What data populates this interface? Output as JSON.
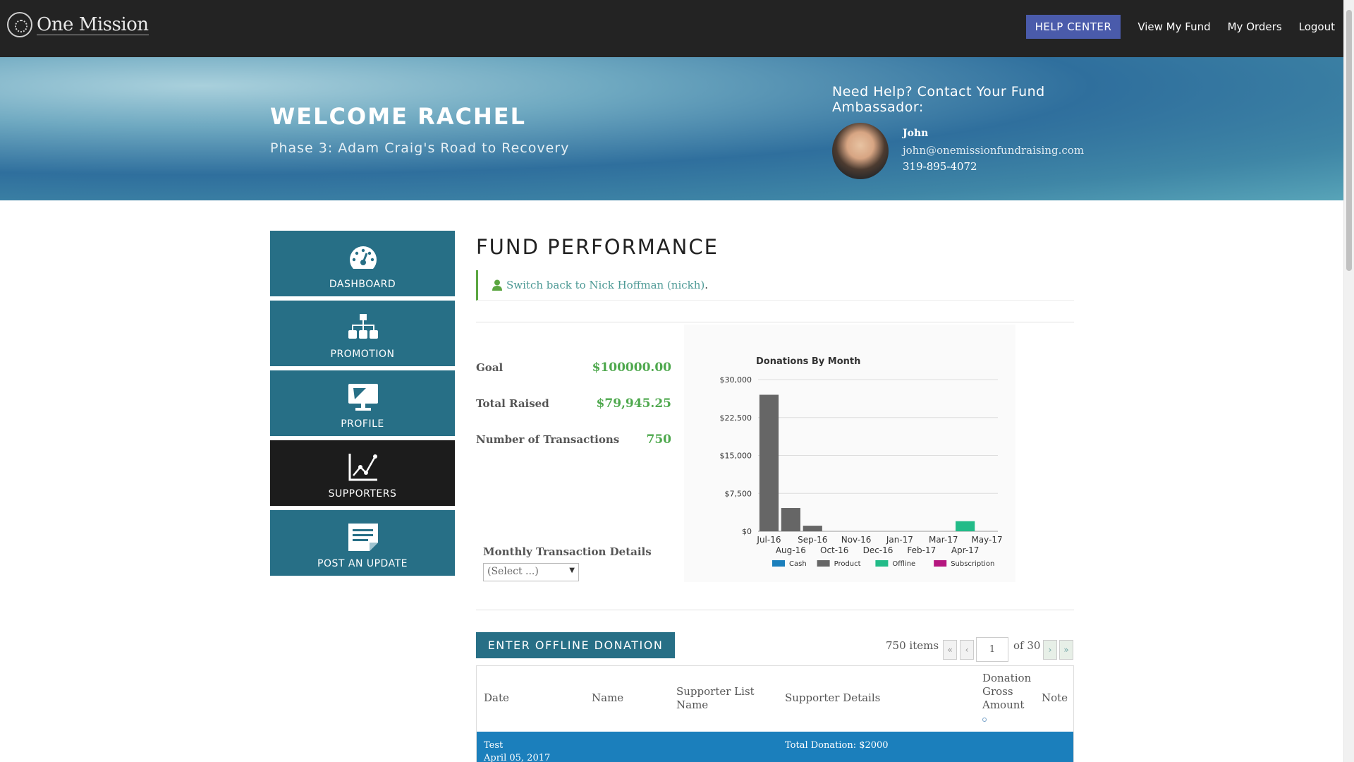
{
  "topbar": {
    "logo_text": "One Mission",
    "nav": {
      "help": "HELP CENTER",
      "view_fund": "View My Fund",
      "orders": "My Orders",
      "logout": "Logout"
    }
  },
  "hero": {
    "welcome": "WELCOME RACHEL",
    "phase": "Phase 3: Adam Craig's Road to Recovery",
    "help_title": "Need Help? Contact Your Fund Ambassador:",
    "ambassador": {
      "name": "John",
      "email": "john@onemissionfundraising.com",
      "phone": "319-895-4072"
    }
  },
  "sidebar": {
    "items": [
      {
        "label": "DASHBOARD",
        "icon": "speedometer-icon"
      },
      {
        "label": "PROMOTION",
        "icon": "sitemap-icon"
      },
      {
        "label": "PROFILE",
        "icon": "monitor-icon"
      },
      {
        "label": "SUPPORTERS",
        "icon": "chart-line-icon",
        "active": true
      },
      {
        "label": "POST AN UPDATE",
        "icon": "note-icon"
      }
    ]
  },
  "main": {
    "title": "FUND PERFORMANCE",
    "switch_text": "Switch back to Nick Hoffman (nickh)",
    "switch_suffix": ".",
    "stats": [
      {
        "label": "Goal",
        "value": "$100000.00"
      },
      {
        "label": "Total Raised",
        "value": "$79,945.25"
      },
      {
        "label": "Number of Transactions",
        "value": "750"
      }
    ],
    "monthly_details_label": "Monthly Transaction Details",
    "monthly_select_value": "(Select ...)",
    "offline_button": "ENTER OFFLINE DONATION",
    "pager": {
      "items": "750 items",
      "page": "1",
      "of": "of 30",
      "first": "«",
      "prev": "‹",
      "next": "›",
      "last": "»"
    },
    "table": {
      "headers": [
        "Date",
        "Name",
        "Supporter List Name",
        "Supporter Details",
        "Donation Gross Amount",
        "Note"
      ],
      "row": {
        "date": "Test",
        "date2": "April 05, 2017",
        "details": "Total Donation: $2000"
      }
    }
  },
  "colors": {
    "cash": "#1b7fbc",
    "product": "#666666",
    "offline": "#22bb88",
    "subscription": "#b5177f",
    "accent": "#276f86",
    "help_button": "#4a5bab"
  },
  "chart_data": {
    "type": "bar",
    "title": "Donations By Month",
    "categories": [
      "Jul-16",
      "Aug-16",
      "Sep-16",
      "Oct-16",
      "Nov-16",
      "Dec-16",
      "Jan-17",
      "Feb-17",
      "Mar-17",
      "Apr-17",
      "May-17"
    ],
    "y_ticks": [
      "$0",
      "$7,500",
      "$15,000",
      "$22,500",
      "$30,000"
    ],
    "ylim": [
      0,
      30000
    ],
    "series": [
      {
        "name": "Cash",
        "color": "#1b7fbc",
        "values": [
          0,
          0,
          0,
          0,
          0,
          0,
          0,
          0,
          0,
          0,
          0
        ]
      },
      {
        "name": "Product",
        "color": "#666666",
        "values": [
          27000,
          4600,
          1100,
          0,
          0,
          0,
          0,
          0,
          0,
          0,
          0
        ]
      },
      {
        "name": "Offline",
        "color": "#22bb88",
        "values": [
          0,
          0,
          0,
          0,
          0,
          0,
          0,
          0,
          0,
          2000,
          0
        ]
      },
      {
        "name": "Subscription",
        "color": "#b5177f",
        "values": [
          0,
          0,
          0,
          0,
          0,
          0,
          0,
          0,
          0,
          0,
          0
        ]
      }
    ],
    "legend_position": "bottom",
    "grid": true
  }
}
